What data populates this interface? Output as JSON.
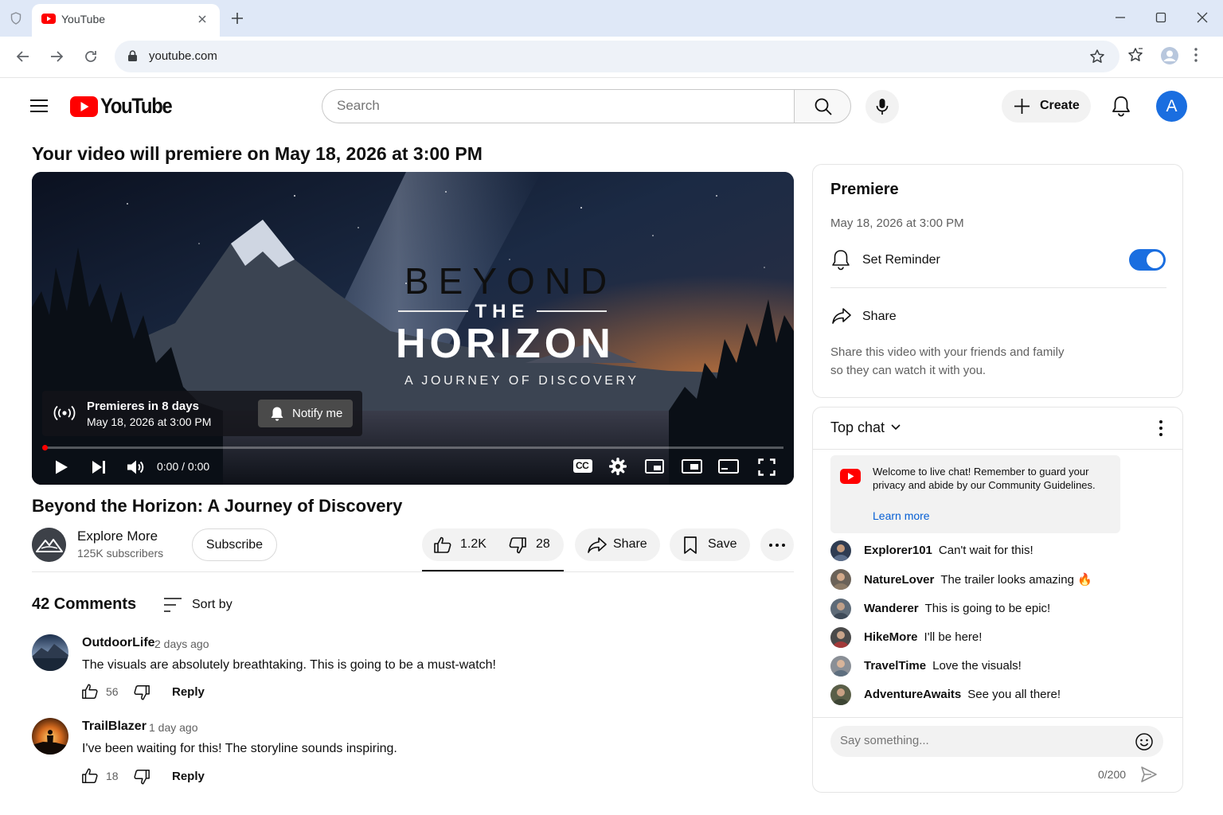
{
  "browser": {
    "tab_title": "YouTube",
    "url": "youtube.com"
  },
  "header": {
    "logo_text": "YouTube",
    "search_placeholder": "Search",
    "create_label": "Create",
    "avatar_letter": "A"
  },
  "page": {
    "premiere_heading": "Your video will premiere on May 18, 2026 at 3:00 PM"
  },
  "player": {
    "art_line1": "BEYOND",
    "art_line2": "THE",
    "art_line3": "HORIZON",
    "art_subtitle": "A JOURNEY OF DISCOVERY",
    "overlay_title": "Premieres in 8 days",
    "overlay_date": "May 18, 2026 at 3:00 PM",
    "notify_label": "Notify me",
    "time": "0:00 / 0:00",
    "cc_label": "CC"
  },
  "video": {
    "title": "Beyond the Horizon: A Journey of Discovery",
    "channel_name": "Explore More",
    "channel_subs": "125K subscribers",
    "subscribe_label": "Subscribe",
    "likes": "1.2K",
    "dislikes": "28",
    "share_label": "Share",
    "save_label": "Save"
  },
  "comments": {
    "count_label": "42 Comments",
    "sort_label": "Sort by",
    "reply_label": "Reply",
    "items": [
      {
        "author": "OutdoorLife",
        "time": "2 days ago",
        "text": "The visuals are absolutely breathtaking. This is going to be a must-watch!",
        "likes": "56"
      },
      {
        "author": "TrailBlazer",
        "time": "1 day ago",
        "text": "I've been waiting for this! The storyline sounds inspiring.",
        "likes": "18"
      }
    ]
  },
  "premiere_card": {
    "title": "Premiere",
    "date": "May 18, 2026 at 3:00 PM",
    "reminder_label": "Set Reminder",
    "reminder_on": true,
    "share_label": "Share",
    "share_desc": "Share this video with your friends and family so they can watch it with you."
  },
  "chat": {
    "mode_label": "Top chat",
    "welcome_text": "Welcome to live chat! Remember to guard your privacy and abide by our Community Guidelines.",
    "learn_more": "Learn more",
    "messages": [
      {
        "author": "Explorer101",
        "text": "Can't wait for this!"
      },
      {
        "author": "NatureLover",
        "text": "The trailer looks amazing 🔥"
      },
      {
        "author": "Wanderer",
        "text": "This is going to be epic!"
      },
      {
        "author": "HikeMore",
        "text": "I'll be here!"
      },
      {
        "author": "TravelTime",
        "text": "Love the visuals!"
      },
      {
        "author": "AdventureAwaits",
        "text": "See you all there!"
      }
    ],
    "input_placeholder": "Say something...",
    "char_count": "0/200"
  },
  "colors": {
    "brand_red": "#ff0000",
    "accent_blue": "#1a6ee0",
    "link_blue": "#065fd4"
  }
}
